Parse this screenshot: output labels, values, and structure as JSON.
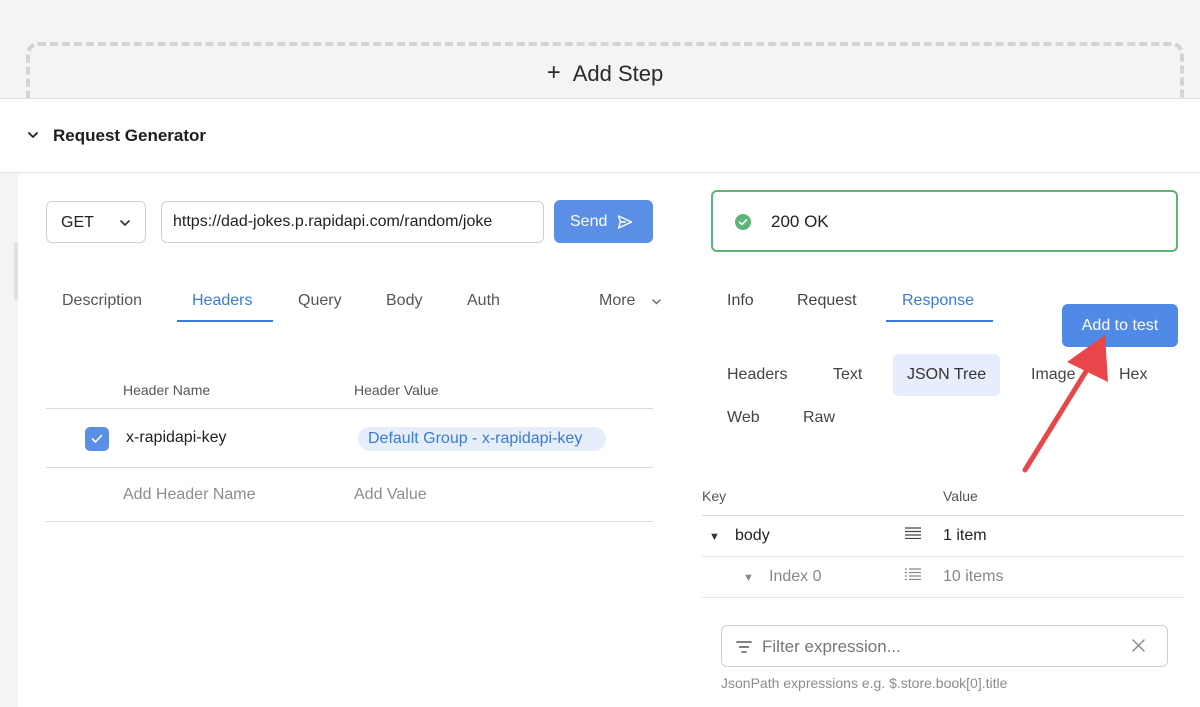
{
  "add_step": {
    "plus": "+",
    "label": "Add Step"
  },
  "section": {
    "title": "Request Generator"
  },
  "request": {
    "method": "GET",
    "url": "https://dad-jokes.p.rapidapi.com/random/joke",
    "send_label": "Send"
  },
  "request_tabs": [
    "Description",
    "Headers",
    "Query",
    "Body",
    "Auth",
    "More"
  ],
  "headers_table": {
    "col_name": "Header Name",
    "col_value": "Header Value",
    "rows": [
      {
        "name": "x-rapidapi-key",
        "value": "Default Group - x-rapidapi-key",
        "checked": true
      }
    ],
    "add_name_placeholder": "Add Header Name",
    "add_value_placeholder": "Add Value"
  },
  "status": {
    "text": "200 OK",
    "color": "#5cb47a"
  },
  "response_tabs": [
    "Info",
    "Request",
    "Response"
  ],
  "add_to_test_label": "Add to test",
  "response_subtabs": [
    "Headers",
    "Text",
    "JSON Tree",
    "Image",
    "Hex",
    "Web",
    "Raw"
  ],
  "json_tree": {
    "col_key": "Key",
    "col_value": "Value",
    "rows": [
      {
        "key": "body",
        "value": "1 item"
      },
      {
        "key": "Index 0",
        "value": "10 items"
      }
    ]
  },
  "filter": {
    "placeholder": "Filter expression...",
    "hint": "JsonPath expressions e.g. $.store.book[0].title"
  },
  "colors": {
    "accent": "#3a7bd5",
    "button": "#5b8fe6",
    "annotation_arrow": "#e8464a"
  }
}
